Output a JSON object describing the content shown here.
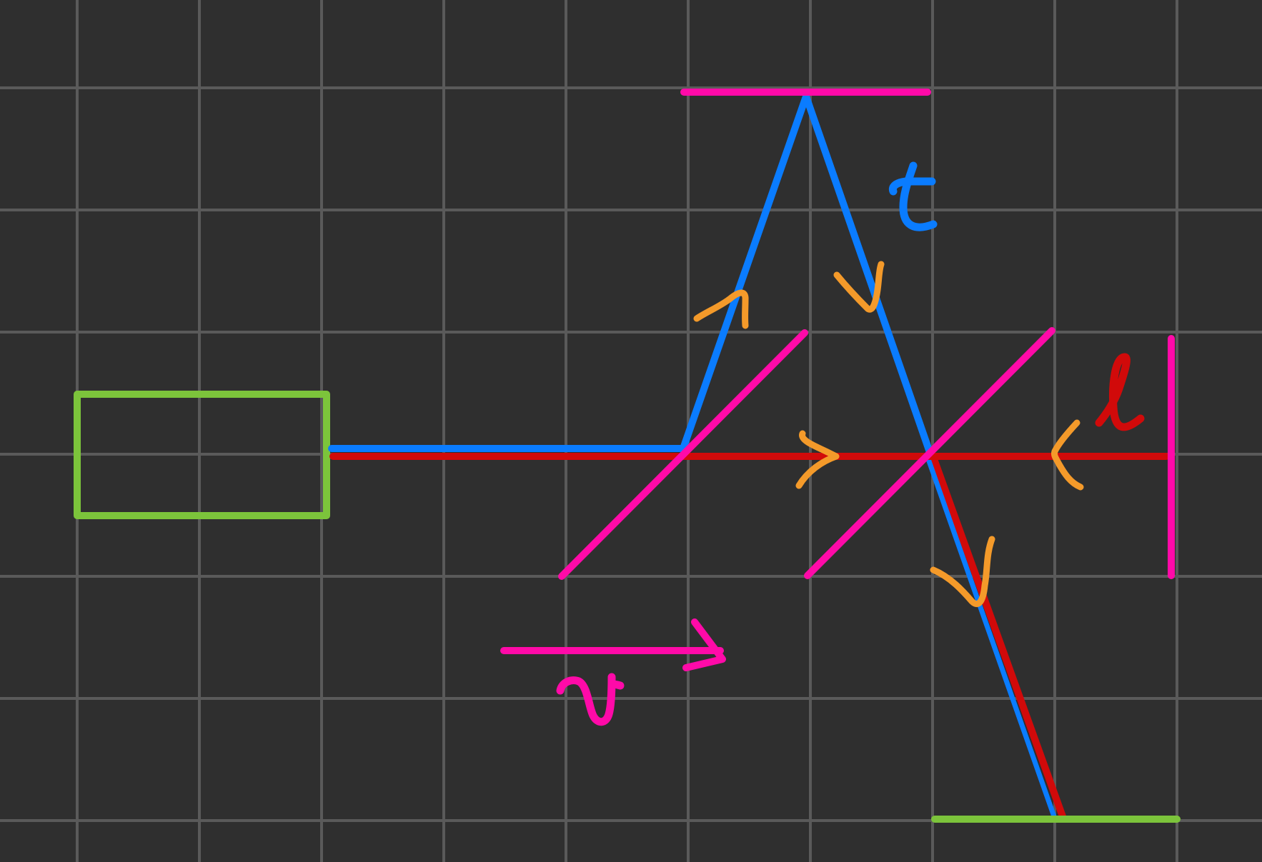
{
  "diagram": {
    "labels": {
      "time": "t",
      "length": "l",
      "velocity": "v"
    },
    "colors": {
      "background": "#2f2f2f",
      "grid": "#5a5a5a",
      "mirror": "#ff0aa8",
      "light_path_blue": "#0a7cff",
      "light_path_red": "#d10a0a",
      "source_and_detector": "#7cc43b",
      "direction_arrows": "#f49a2a"
    }
  }
}
